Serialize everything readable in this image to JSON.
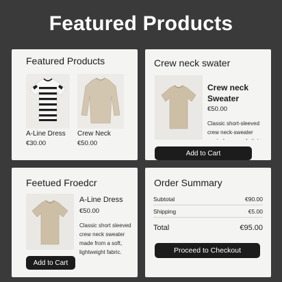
{
  "hero": {
    "title": "Featured Products"
  },
  "card1": {
    "title": "Featured Products",
    "products": [
      {
        "name": "A-Line Dress",
        "price": "€30.00",
        "image_icon": "striped-tshirt-icon"
      },
      {
        "name": "Crew Neck",
        "price": "€50.00",
        "image_icon": "beige-sweater-icon"
      }
    ]
  },
  "card2": {
    "title": "Crew neck swater",
    "product": {
      "name": "Crew neck Sweater",
      "price": "€50.00",
      "description": "Classic short-sleeved crew neck-sweater made from a soft, light-",
      "image_icon": "beige-tshirt-icon"
    },
    "add_to_cart": "Add to Cart"
  },
  "card3": {
    "title": "Feetued Froedcr",
    "product": {
      "name": "A-Line Dress",
      "price": "€50.00",
      "description": "Classic short sleeved crew neck sweater made from a soft, lightweight fabric.",
      "image_icon": "beige-tshirt-icon"
    },
    "add_to_cart": "Add to Cart"
  },
  "summary": {
    "title": "Order Summary",
    "rows": [
      {
        "label": "Subtotal",
        "value": "€90.00"
      },
      {
        "label": "Shipping",
        "value": "€5.00"
      }
    ],
    "total": {
      "label": "Total",
      "value": "€95.00"
    },
    "checkout": "Proceed to Checkout"
  },
  "colors": {
    "background": "#3a3a3a",
    "card": "#f4f4f2",
    "button": "#1c1c1c",
    "garment": "#cdbfa6"
  }
}
